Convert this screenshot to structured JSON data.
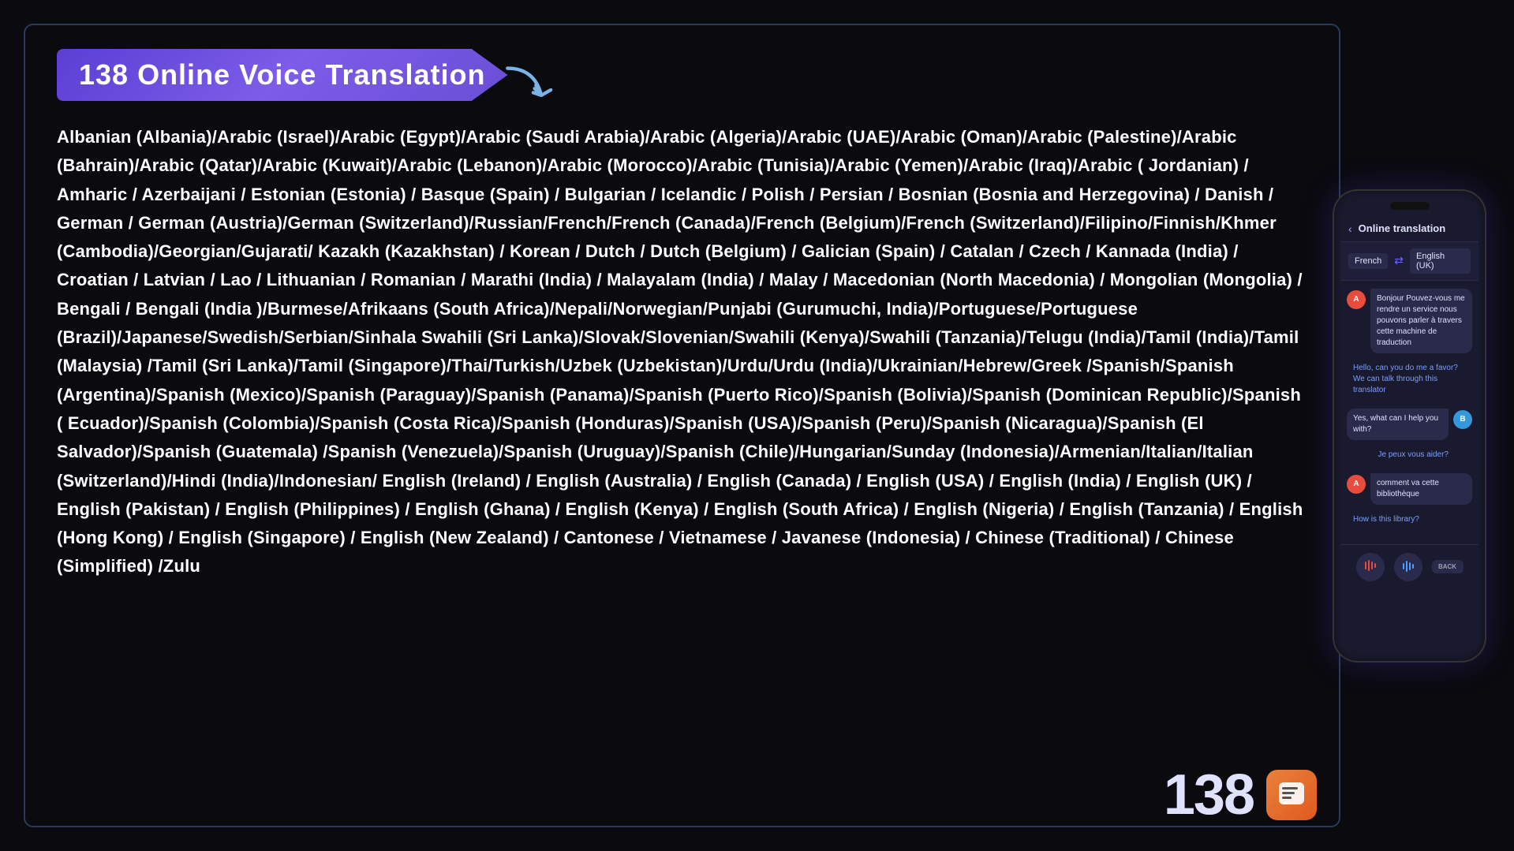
{
  "title": {
    "text": "138 Online Voice Translation",
    "bg_color": "#6a4fd6"
  },
  "languages": {
    "content": "Albanian (Albania)/Arabic (Israel)/Arabic (Egypt)/Arabic (Saudi Arabia)/Arabic (Algeria)/Arabic (UAE)/Arabic (Oman)/Arabic (Palestine)/Arabic (Bahrain)/Arabic (Qatar)/Arabic (Kuwait)/Arabic (Lebanon)/Arabic (Morocco)/Arabic (Tunisia)/Arabic (Yemen)/Arabic (Iraq)/Arabic ( Jordanian) / Amharic / Azerbaijani / Estonian (Estonia) / Basque (Spain) / Bulgarian / Icelandic / Polish / Persian / Bosnian (Bosnia and Herzegovina) / Danish / German / German (Austria)/German (Switzerland)/Russian/French/French (Canada)/French (Belgium)/French (Switzerland)/Filipino/Finnish/Khmer (Cambodia)/Georgian/Gujarati/ Kazakh (Kazakhstan) / Korean / Dutch / Dutch (Belgium) / Galician (Spain) / Catalan / Czech / Kannada (India) / Croatian / Latvian / Lao / Lithuanian / Romanian / Marathi (India) / Malayalam (India) / Malay / Macedonian (North Macedonia) / Mongolian (Mongolia) / Bengali / Bengali (India )/Burmese/Afrikaans (South Africa)/Nepali/Norwegian/Punjabi (Gurumuchi, India)/Portuguese/Portuguese (Brazil)/Japanese/Swedish/Serbian/Sinhala Swahili (Sri Lanka)/Slovak/Slovenian/Swahili (Kenya)/Swahili (Tanzania)/Telugu (India)/Tamil (India)/Tamil (Malaysia) /Tamil (Sri Lanka)/Tamil (Singapore)/Thai/Turkish/Uzbek (Uzbekistan)/Urdu/Urdu (India)/Ukrainian/Hebrew/Greek /Spanish/Spanish (Argentina)/Spanish (Mexico)/Spanish (Paraguay)/Spanish (Panama)/Spanish (Puerto Rico)/Spanish (Bolivia)/Spanish (Dominican Republic)/Spanish ( Ecuador)/Spanish (Colombia)/Spanish (Costa Rica)/Spanish (Honduras)/Spanish (USA)/Spanish (Peru)/Spanish (Nicaragua)/Spanish (El Salvador)/Spanish (Guatemala) /Spanish (Venezuela)/Spanish (Uruguay)/Spanish (Chile)/Hungarian/Sunday (Indonesia)/Armenian/Italian/Italian (Switzerland)/Hindi (India)/Indonesian/ English (Ireland) / English (Australia) / English (Canada) / English (USA) / English (India) / English (UK) / English (Pakistan) / English (Philippines) / English (Ghana) / English (Kenya) / English (South Africa) / English (Nigeria) / English (Tanzania) / English (Hong Kong) / English (Singapore) / English (New Zealand) / Cantonese / Vietnamese / Javanese (Indonesia) / Chinese (Traditional) / Chinese (Simplified) /Zulu"
  },
  "phone": {
    "header": {
      "back_label": "‹",
      "title": "Online translation"
    },
    "lang_from": "French",
    "lang_to": "English (UK)",
    "chat": [
      {
        "side": "left",
        "avatar": "A",
        "bubble": "Bonjour Pouvez-vous me rendre un service nous pouvons parler à travers cette machine de traduction",
        "translated": "Hello, can you do me a favor? We can talk through this translator"
      },
      {
        "side": "right",
        "avatar": "B",
        "bubble": "Yes, what can I help you with?",
        "translated": "Je peux vous aider?"
      },
      {
        "side": "left",
        "avatar": "A",
        "bubble": "comment va cette bibliothèque",
        "translated": "How is this library?"
      }
    ],
    "buttons": {
      "mic_a": "🎤",
      "mic_b": "📊",
      "back": "BACK"
    }
  },
  "badge": {
    "number": "138",
    "icon": "💬"
  }
}
